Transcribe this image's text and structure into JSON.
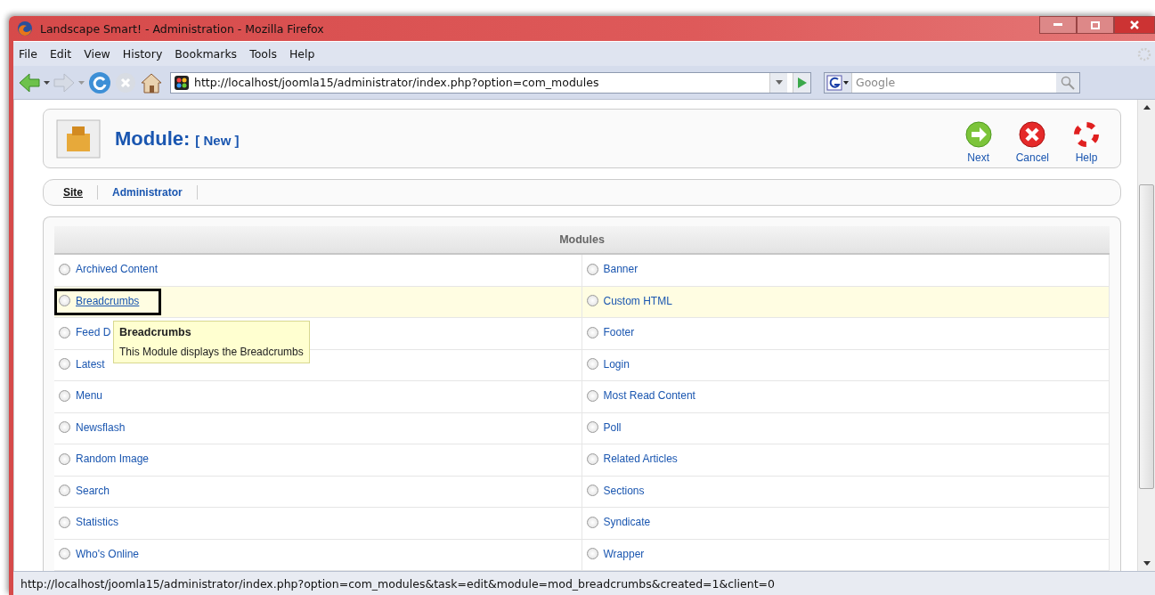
{
  "window": {
    "title": "Landscape Smart! - Administration - Mozilla Firefox"
  },
  "menu": [
    {
      "label": "File"
    },
    {
      "label": "Edit"
    },
    {
      "label": "View"
    },
    {
      "label": "History"
    },
    {
      "label": "Bookmarks"
    },
    {
      "label": "Tools"
    },
    {
      "label": "Help"
    }
  ],
  "address": {
    "value": "http://localhost/joomla15/administrator/index.php?option=com_modules"
  },
  "search": {
    "placeholder": "Google"
  },
  "header": {
    "title": "Module:",
    "subtitle": "[ New ]",
    "actions": [
      {
        "label": "Next",
        "kind": "next"
      },
      {
        "label": "Cancel",
        "kind": "cancel"
      },
      {
        "label": "Help",
        "kind": "help"
      }
    ]
  },
  "tabs": [
    {
      "label": "Site",
      "selected": true
    },
    {
      "label": "Administrator",
      "selected": false
    }
  ],
  "table": {
    "heading": "Modules",
    "rows": [
      {
        "highlighted": false,
        "cells": [
          {
            "label": "Archived Content",
            "hovered": false,
            "outlined": false
          },
          {
            "label": "Banner",
            "hovered": false,
            "outlined": false
          }
        ]
      },
      {
        "highlighted": true,
        "cells": [
          {
            "label": "Breadcrumbs",
            "hovered": true,
            "outlined": true
          },
          {
            "label": "Custom HTML",
            "hovered": false,
            "outlined": false
          }
        ]
      },
      {
        "highlighted": false,
        "cells": [
          {
            "label": "Feed D",
            "hovered": false,
            "outlined": false
          },
          {
            "label": "Footer",
            "hovered": false,
            "outlined": false
          }
        ]
      },
      {
        "highlighted": false,
        "cells": [
          {
            "label": "Latest",
            "hovered": false,
            "outlined": false
          },
          {
            "label": "Login",
            "hovered": false,
            "outlined": false
          }
        ]
      },
      {
        "highlighted": false,
        "cells": [
          {
            "label": "Menu",
            "hovered": false,
            "outlined": false
          },
          {
            "label": "Most Read Content",
            "hovered": false,
            "outlined": false
          }
        ]
      },
      {
        "highlighted": false,
        "cells": [
          {
            "label": "Newsflash",
            "hovered": false,
            "outlined": false
          },
          {
            "label": "Poll",
            "hovered": false,
            "outlined": false
          }
        ]
      },
      {
        "highlighted": false,
        "cells": [
          {
            "label": "Random Image",
            "hovered": false,
            "outlined": false
          },
          {
            "label": "Related Articles",
            "hovered": false,
            "outlined": false
          }
        ]
      },
      {
        "highlighted": false,
        "cells": [
          {
            "label": "Search",
            "hovered": false,
            "outlined": false
          },
          {
            "label": "Sections",
            "hovered": false,
            "outlined": false
          }
        ]
      },
      {
        "highlighted": false,
        "cells": [
          {
            "label": "Statistics",
            "hovered": false,
            "outlined": false
          },
          {
            "label": "Syndicate",
            "hovered": false,
            "outlined": false
          }
        ]
      },
      {
        "highlighted": false,
        "cells": [
          {
            "label": "Who's Online",
            "hovered": false,
            "outlined": false
          },
          {
            "label": "Wrapper",
            "hovered": false,
            "outlined": false
          }
        ]
      }
    ]
  },
  "tooltip": {
    "title": "Breadcrumbs",
    "text": "This Module displays the Breadcrumbs"
  },
  "status_bar": {
    "text": "http://localhost/joomla15/administrator/index.php?option=com_modules&task=edit&module=mod_breadcrumbs&created=1&client=0"
  }
}
